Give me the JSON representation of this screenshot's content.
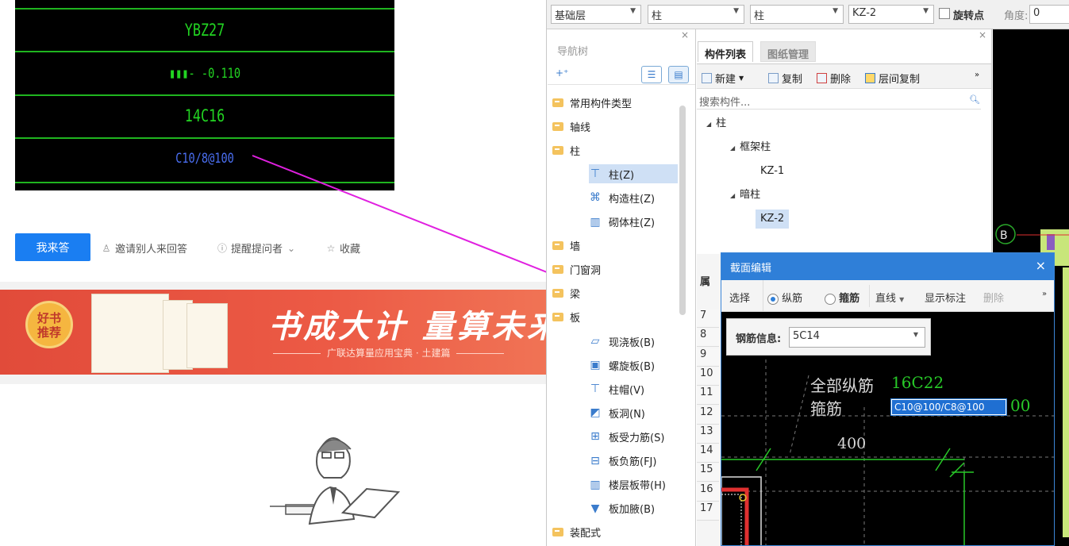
{
  "cad_snippet": {
    "lines": [
      "YBZ27",
      "▮▮▮- -0.110",
      "14C16",
      "C10/8@100"
    ]
  },
  "actions": {
    "answer": "我来答",
    "invite": "邀请别人来回答",
    "remind": "提醒提问者",
    "collect": "收藏"
  },
  "banner": {
    "badge": [
      "好书",
      "推荐"
    ],
    "slogan": "书成大计  量算未来",
    "subtitle": "广联达算量应用宝典 · 土建篇"
  },
  "toolbar": {
    "floor": "基础层",
    "category": "柱",
    "subcategory": "柱",
    "component": "KZ-2",
    "rotate_label": "旋转点",
    "angle_label": "角度:",
    "angle_value": "0"
  },
  "nav": {
    "title": "导航树",
    "items": [
      {
        "label": "常用构件类型",
        "type": "folder"
      },
      {
        "label": "轴线",
        "type": "folder"
      },
      {
        "label": "柱",
        "type": "folder-open"
      },
      {
        "label": "柱(Z)",
        "type": "child",
        "icon": "column-icon",
        "selected": true
      },
      {
        "label": "构造柱(Z)",
        "type": "child",
        "icon": "construct-column-icon"
      },
      {
        "label": "砌体柱(Z)",
        "type": "child",
        "icon": "masonry-column-icon"
      },
      {
        "label": "墙",
        "type": "folder"
      },
      {
        "label": "门窗洞",
        "type": "folder"
      },
      {
        "label": "梁",
        "type": "folder"
      },
      {
        "label": "板",
        "type": "folder-open"
      },
      {
        "label": "现浇板(B)",
        "type": "child",
        "icon": "slab-icon"
      },
      {
        "label": "螺旋板(B)",
        "type": "child",
        "icon": "spiral-slab-icon"
      },
      {
        "label": "柱帽(V)",
        "type": "child",
        "icon": "column-cap-icon"
      },
      {
        "label": "板洞(N)",
        "type": "child",
        "icon": "slab-hole-icon"
      },
      {
        "label": "板受力筋(S)",
        "type": "child",
        "icon": "slab-rebar-icon"
      },
      {
        "label": "板负筋(FJ)",
        "type": "child",
        "icon": "negative-rebar-icon"
      },
      {
        "label": "楼层板带(H)",
        "type": "child",
        "icon": "slab-strip-icon"
      },
      {
        "label": "板加腋(B)",
        "type": "child",
        "icon": "slab-haunch-icon"
      },
      {
        "label": "装配式",
        "type": "folder"
      }
    ]
  },
  "components": {
    "tabs": [
      "构件列表",
      "图纸管理"
    ],
    "toolbar": {
      "new": "新建",
      "copy": "复制",
      "delete": "删除",
      "floor_copy": "层间复制"
    },
    "search_placeholder": "搜索构件...",
    "tree": {
      "root": "柱",
      "group1": "框架柱",
      "item1": "KZ-1",
      "group2": "暗柱",
      "item2": "KZ-2"
    }
  },
  "props": {
    "label": "属",
    "rows": [
      "7",
      "8",
      "9",
      "10",
      "11",
      "12",
      "13",
      "14",
      "15",
      "16",
      "17"
    ]
  },
  "dialog": {
    "title": "截面编辑",
    "select": "选择",
    "longitudinal": "纵筋",
    "stirrup": "箍筋",
    "line_mode": "直线",
    "show_label": "显示标注",
    "delete": "删除",
    "rebar_info_label": "钢筋信息:",
    "rebar_info_value": "5C14",
    "all_long_label": "全部纵筋",
    "all_long_value": "16C22",
    "stirrup_label": "箍筋",
    "stirrup_value": "C10@100/C8@100",
    "stirrup_tail": "00",
    "dimension": "400",
    "axis_label": "B"
  },
  "colors": {
    "accent": "#2f7fd8",
    "cad_green": "#22d422",
    "banner_red": "#e14b3a",
    "arrow": "#e020e0"
  }
}
